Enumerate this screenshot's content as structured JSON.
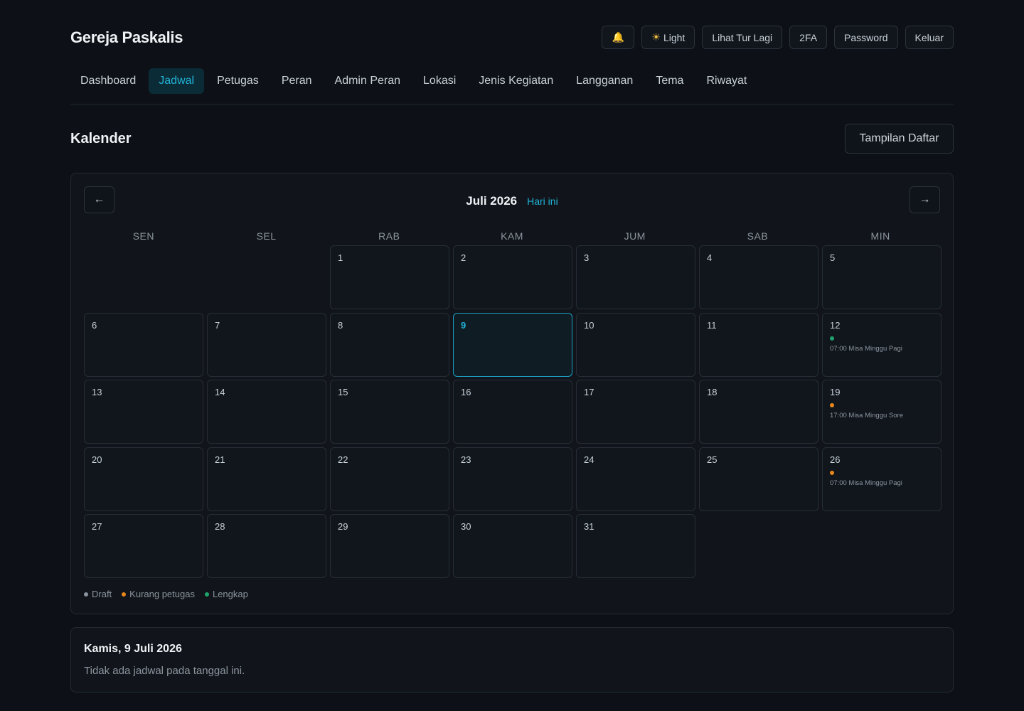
{
  "header": {
    "brand": "Gereja Paskalis",
    "bell_icon": "🔔",
    "theme_label": "Light",
    "tour_label": "Lihat Tur Lagi",
    "twofa_label": "2FA",
    "password_label": "Password",
    "logout_label": "Keluar"
  },
  "nav": {
    "tabs": [
      {
        "label": "Dashboard",
        "active": false
      },
      {
        "label": "Jadwal",
        "active": true
      },
      {
        "label": "Petugas",
        "active": false
      },
      {
        "label": "Peran",
        "active": false
      },
      {
        "label": "Admin Peran",
        "active": false
      },
      {
        "label": "Lokasi",
        "active": false
      },
      {
        "label": "Jenis Kegiatan",
        "active": false
      },
      {
        "label": "Langganan",
        "active": false
      },
      {
        "label": "Tema",
        "active": false
      },
      {
        "label": "Riwayat",
        "active": false
      }
    ]
  },
  "page": {
    "title": "Kalender",
    "list_view_label": "Tampilan Daftar"
  },
  "calendar": {
    "prev_icon": "←",
    "next_icon": "→",
    "month_label": "Juli 2026",
    "today_label": "Hari ini",
    "weekdays": [
      "SEN",
      "SEL",
      "RAB",
      "KAM",
      "JUM",
      "SAB",
      "MIN"
    ],
    "leading_blanks": 2,
    "days_in_month": 31,
    "selected_day": 9,
    "events": [
      {
        "day": 12,
        "text": "07:00 Misa Minggu Pagi",
        "status": "lengkap"
      },
      {
        "day": 19,
        "text": "17:00 Misa Minggu Sore",
        "status": "kurang"
      },
      {
        "day": 26,
        "text": "07:00 Misa Minggu Pagi",
        "status": "kurang"
      }
    ],
    "status_colors": {
      "draft": "#8b949e",
      "kurang": "#e8861a",
      "lengkap": "#1fa56b"
    },
    "legend": [
      {
        "label": "Draft",
        "status": "draft"
      },
      {
        "label": "Kurang petugas",
        "status": "kurang"
      },
      {
        "label": "Lengkap",
        "status": "lengkap"
      }
    ]
  },
  "detail": {
    "date_title": "Kamis, 9 Juli 2026",
    "empty_text": "Tidak ada jadwal pada tanggal ini."
  }
}
